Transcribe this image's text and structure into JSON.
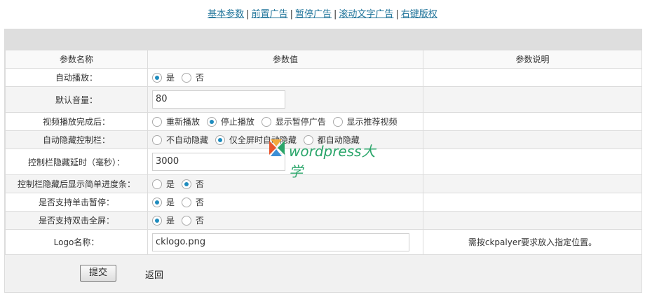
{
  "nav": {
    "links": [
      "基本参数",
      "前置广告",
      "暂停广告",
      "滚动文字广告",
      "右键版权"
    ],
    "separator": "|"
  },
  "table": {
    "headers": [
      "参数名称",
      "参数值",
      "参数说明"
    ],
    "rows": {
      "autoplay": {
        "label": "自动播放：",
        "options": [
          "是",
          "否"
        ],
        "selected": "是"
      },
      "volume": {
        "label": "默认音量：",
        "value": "80"
      },
      "after_play": {
        "label": "视频播放完成后：",
        "options": [
          "重新播放",
          "停止播放",
          "显示暂停广告",
          "显示推荐视频"
        ],
        "selected": "停止播放"
      },
      "autohide": {
        "label": "自动隐藏控制栏：",
        "options": [
          "不自动隐藏",
          "仅全屏时自动隐藏",
          "都自动隐藏"
        ],
        "selected": "仅全屏时自动隐藏"
      },
      "hide_delay": {
        "label": "控制栏隐藏延时（毫秒）：",
        "value": "3000"
      },
      "progress": {
        "label": "控制栏隐藏后显示简单进度条：",
        "options": [
          "是",
          "否"
        ],
        "selected": "否"
      },
      "click_pause": {
        "label": "是否支持单击暂停：",
        "options": [
          "是",
          "否"
        ],
        "selected": "是"
      },
      "dblclick_full": {
        "label": "是否支持双击全屏：",
        "options": [
          "是",
          "否"
        ],
        "selected": "是"
      },
      "logo": {
        "label": "Logo名称：",
        "value": "cklogo.png",
        "desc": "需按ckpalyer要求放入指定位置。"
      }
    }
  },
  "footer": {
    "submit": "提交",
    "back": "返回"
  },
  "watermark": {
    "text": "wordpress大学",
    "color": "#2aa56a"
  }
}
